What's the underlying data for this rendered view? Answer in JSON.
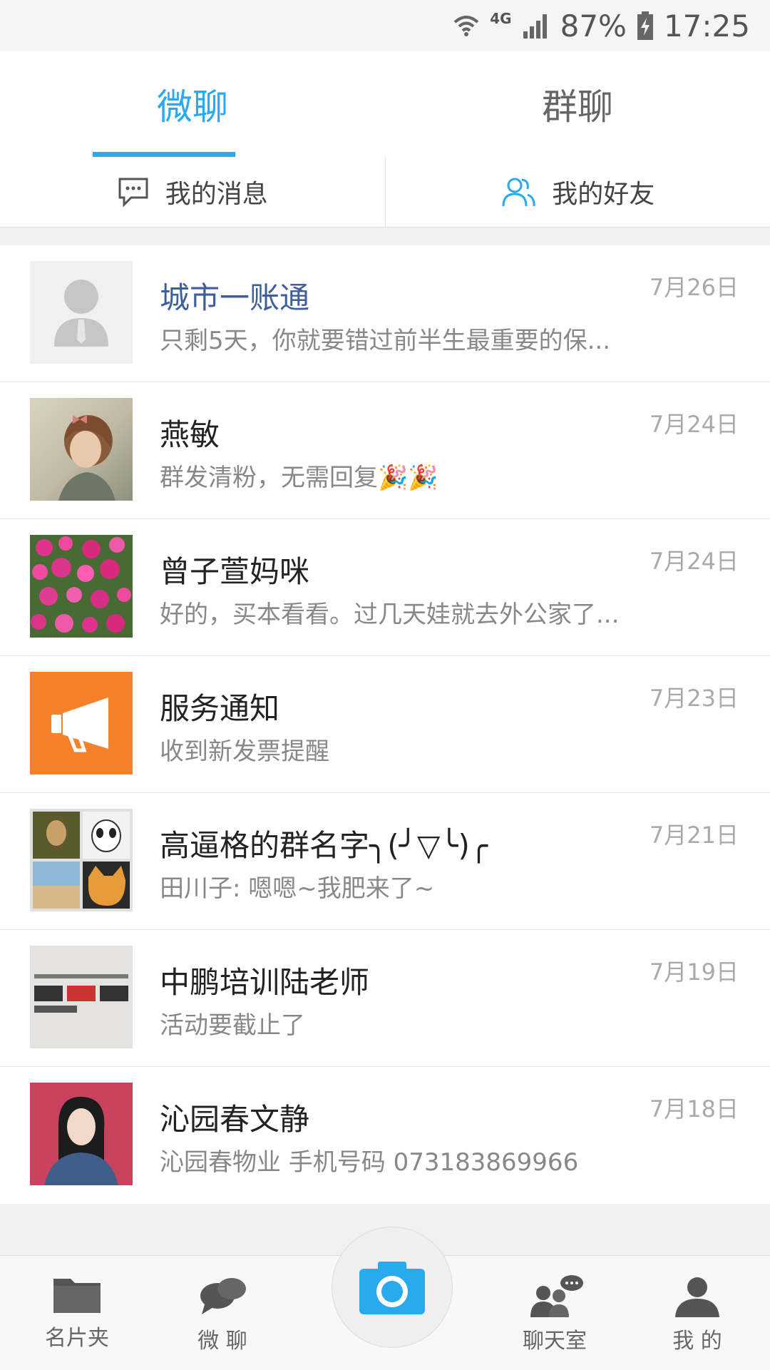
{
  "status_bar": {
    "network": "4G",
    "battery": "87%",
    "time": "17:25"
  },
  "tabs": [
    {
      "label": "微聊",
      "active": true
    },
    {
      "label": "群聊",
      "active": false
    }
  ],
  "subtabs": [
    {
      "label": "我的消息",
      "icon": "chat-bubble-icon"
    },
    {
      "label": "我的好友",
      "icon": "friends-icon"
    }
  ],
  "conversations": [
    {
      "name": "城市一账通",
      "preview": "只剩5天，你就要错过前半生最重要的保...",
      "date": "7月26日",
      "avatar": "default-person-avatar"
    },
    {
      "name": "燕敏",
      "preview": "群发清粉，无需回复🎉🎉",
      "date": "7月24日",
      "avatar": "girl-photo-avatar"
    },
    {
      "name": "曾子萱妈咪",
      "preview": "好的，买本看看。过几天娃就去外公家了...",
      "date": "7月24日",
      "avatar": "flowers-photo-avatar"
    },
    {
      "name": "服务通知",
      "preview": "收到新发票提醒",
      "date": "7月23日",
      "avatar": "megaphone-avatar"
    },
    {
      "name": "高逼格的群名字╮(╯▽╰)╭",
      "preview": "田川子: 嗯嗯~我肥来了~",
      "date": "7月21日",
      "avatar": "group-collage-avatar"
    },
    {
      "name": "中鹏培训陆老师",
      "preview": "活动要截止了",
      "date": "7月19日",
      "avatar": "text-poster-avatar"
    },
    {
      "name": "沁园春文静",
      "preview": "沁园春物业 手机号码 073183869966",
      "date": "7月18日",
      "avatar": "woman-photo-avatar"
    }
  ],
  "bottom_nav": [
    {
      "label": "名片夹",
      "icon": "folder-icon"
    },
    {
      "label": "微 聊",
      "icon": "chat-bubbles-icon"
    },
    {
      "label": "",
      "icon": "camera-icon"
    },
    {
      "label": "聊天室",
      "icon": "chatroom-icon"
    },
    {
      "label": "我 的",
      "icon": "profile-icon"
    }
  ],
  "colors": {
    "accent": "#29a9ee",
    "service_orange": "#f5812a",
    "link_name": "#3e5f9b"
  }
}
